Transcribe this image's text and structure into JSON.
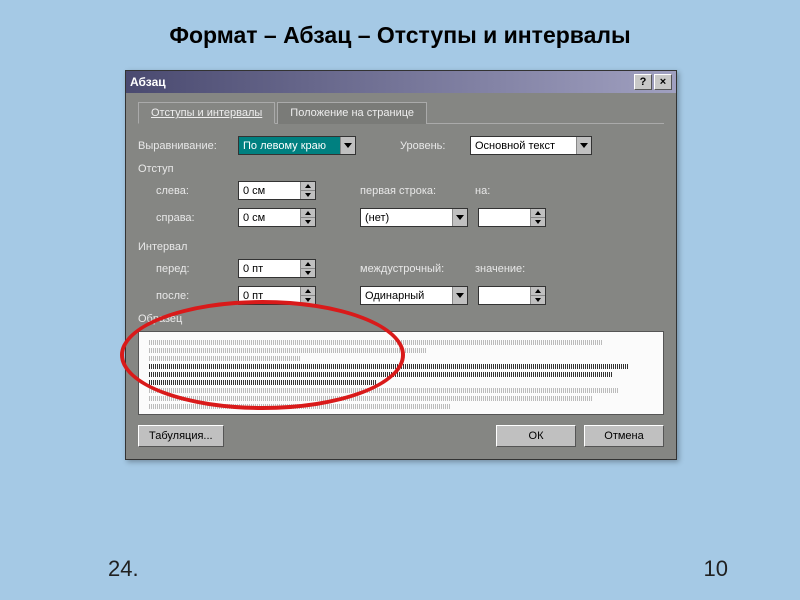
{
  "slide": {
    "title": "Формат – Абзац – Отступы и интервалы",
    "footer_left": "24.",
    "footer_right": "10"
  },
  "dialog": {
    "title": "Абзац",
    "help_btn": "?",
    "close_btn": "×",
    "tabs": {
      "active": "Отступы и интервалы",
      "other": "Положение на странице"
    },
    "alignment_label": "Выравнивание:",
    "alignment_value": "По левому краю",
    "level_label": "Уровень:",
    "level_value": "Основной текст",
    "indent": {
      "group": "Отступ",
      "left_label": "слева:",
      "left_value": "0 см",
      "right_label": "справа:",
      "right_value": "0 см",
      "firstline_label": "первая строка:",
      "firstline_value": "(нет)",
      "by_label": "на:",
      "by_value": ""
    },
    "spacing": {
      "group": "Интервал",
      "before_label": "перед:",
      "before_value": "0 пт",
      "after_label": "после:",
      "after_value": "0 пт",
      "linespacing_label": "междустрочный:",
      "linespacing_value": "Одинарный",
      "at_label": "значение:",
      "at_value": ""
    },
    "preview_label": "Образец",
    "tabs_button": "Табуляция...",
    "ok": "ОК",
    "cancel": "Отмена"
  }
}
